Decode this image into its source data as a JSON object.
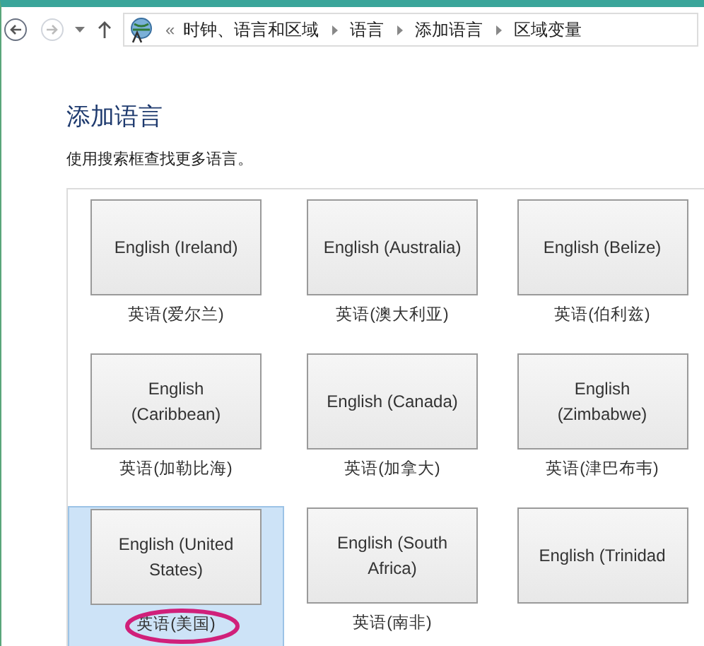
{
  "nav": {
    "overflow": "«",
    "breadcrumbs": [
      "时钟、语言和区域",
      "语言",
      "添加语言",
      "区域变量"
    ]
  },
  "heading": "添加语言",
  "subtitle": "使用搜索框查找更多语言。",
  "languages": [
    {
      "name": "English (Ireland)",
      "label": "英语(爱尔兰)",
      "selected": false,
      "circled": false
    },
    {
      "name": "English (Australia)",
      "label": "英语(澳大利亚)",
      "selected": false,
      "circled": false
    },
    {
      "name": "English (Belize)",
      "label": "英语(伯利兹)",
      "selected": false,
      "circled": false
    },
    {
      "name": "English (Caribbean)",
      "label": "英语(加勒比海)",
      "selected": false,
      "circled": false
    },
    {
      "name": "English (Canada)",
      "label": "英语(加拿大)",
      "selected": false,
      "circled": false
    },
    {
      "name": "English (Zimbabwe)",
      "label": "英语(津巴布韦)",
      "selected": false,
      "circled": false
    },
    {
      "name": "English (United States)",
      "label": "英语(美国)",
      "selected": true,
      "circled": true
    },
    {
      "name": "English (South Africa)",
      "label": "英语(南非)",
      "selected": false,
      "circled": false
    },
    {
      "name": "English (Trinidad",
      "selected": false,
      "circled": false
    }
  ]
}
